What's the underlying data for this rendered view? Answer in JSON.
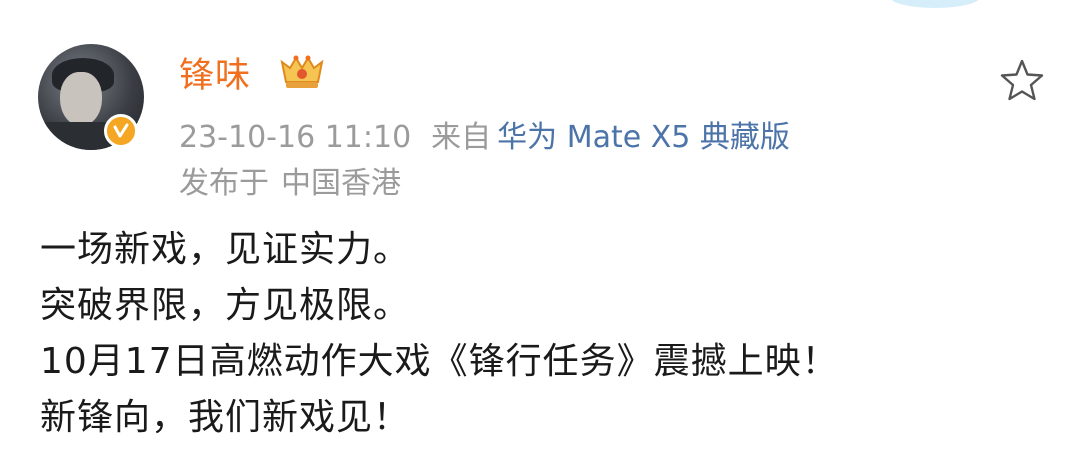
{
  "post": {
    "author": {
      "name": "锋味",
      "verified": true,
      "badge_icon": "crown-level-badge"
    },
    "timestamp": "23-10-16 11:10",
    "source_prefix": "来自",
    "source_device": "华为 Mate X5 典藏版",
    "location_prefix": "发布于",
    "location": "中国香港",
    "content_lines": [
      "一场新戏，见证实力。",
      "突破界限，方见极限。",
      "10月17日高燃动作大戏《锋行任务》震撼上映！",
      "新锋向，我们新戏见！"
    ],
    "favorite_icon": "star-outline-icon"
  },
  "colors": {
    "username": "#f0701f",
    "meta": "#9b9b9b",
    "device_link": "#4d74a8",
    "body_text": "#1a1a1a",
    "verified_badge": "#f5a623"
  }
}
